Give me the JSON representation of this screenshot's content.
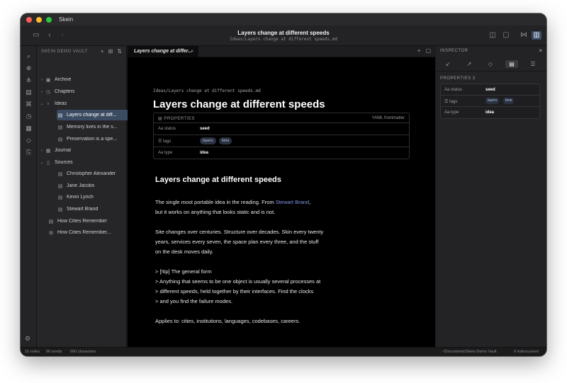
{
  "app": {
    "title": "Skein"
  },
  "toolbar": {
    "doc_title": "Layers change at different speeds",
    "doc_path": "Ideas/Layers change at different speeds.md"
  },
  "sidebar": {
    "header": "SKEIN DEMO VAULT",
    "items": [
      {
        "label": "Archive",
        "icon": "archive-icon"
      },
      {
        "label": "Chapters",
        "icon": "clock-icon"
      },
      {
        "label": "Ideas",
        "icon": "bulb-icon"
      },
      {
        "label": "Layers change at diff...",
        "icon": "note-icon",
        "selected": true
      },
      {
        "label": "Memory lives in the s...",
        "icon": "note-icon"
      },
      {
        "label": "Preservation is a spe...",
        "icon": "note-icon"
      },
      {
        "label": "Journal",
        "icon": "calendar-icon"
      },
      {
        "label": "Sources",
        "icon": "book-icon"
      },
      {
        "label": "Christopher Alexander",
        "icon": "note-icon"
      },
      {
        "label": "Jane Jacobs",
        "icon": "note-icon"
      },
      {
        "label": "Kevin Lynch",
        "icon": "note-icon"
      },
      {
        "label": "Stewart Brand",
        "icon": "note-icon"
      },
      {
        "label": "How Cities Remember",
        "icon": "note-icon"
      },
      {
        "label": "How Cities Remember...",
        "icon": "grid-icon"
      }
    ]
  },
  "tab": {
    "label": "Layers change at differ..."
  },
  "editor": {
    "breadcrumb": "Ideas/Layers change at different speeds.md",
    "title": "Layers change at different speeds",
    "properties": {
      "header": "PROPERTIES",
      "mode": "YAML frontmatter",
      "rows": [
        {
          "key": "status",
          "value": "seed"
        },
        {
          "key": "tags",
          "chips": [
            "layers",
            "time"
          ]
        },
        {
          "key": "type",
          "value": "idea"
        }
      ]
    },
    "heading": "Layers change at different speeds",
    "para1_a": "The single most portable idea in the reading. From ",
    "para1_link": "Stewart Brand",
    "para1_b": ",",
    "para1_line2": "but it works on anything that looks static and is not.",
    "para2_l1": "Site changes over centuries. Structure over decades. Skin every twenty",
    "para2_l2": "years, services every seven, the space plan every three, and the stuff",
    "para2_l3": "on the desk moves daily.",
    "quote_l1": "> [!tip] The general form",
    "quote_l2": "> Anything that seems to be one object is usually several processes at",
    "quote_l3": "> different speeds, held together by their interfaces. Find the clocks",
    "quote_l4": "> and you find the failure modes.",
    "para3": "Applies to: cities, institutions, languages, codebases, careers."
  },
  "inspector": {
    "header": "INSPECTOR",
    "section": "PROPERTIES 3",
    "rows": [
      {
        "key": "status",
        "value": "seed"
      },
      {
        "key": "tags",
        "chips": [
          "layers",
          "time"
        ]
      },
      {
        "key": "type",
        "value": "idea"
      }
    ]
  },
  "statusbar": {
    "notes": "16 notes",
    "words": "96 words",
    "chars": "600 characters",
    "path": "~/Documents/Skein Demo Vault",
    "indexed": "0 indexcurrent"
  }
}
